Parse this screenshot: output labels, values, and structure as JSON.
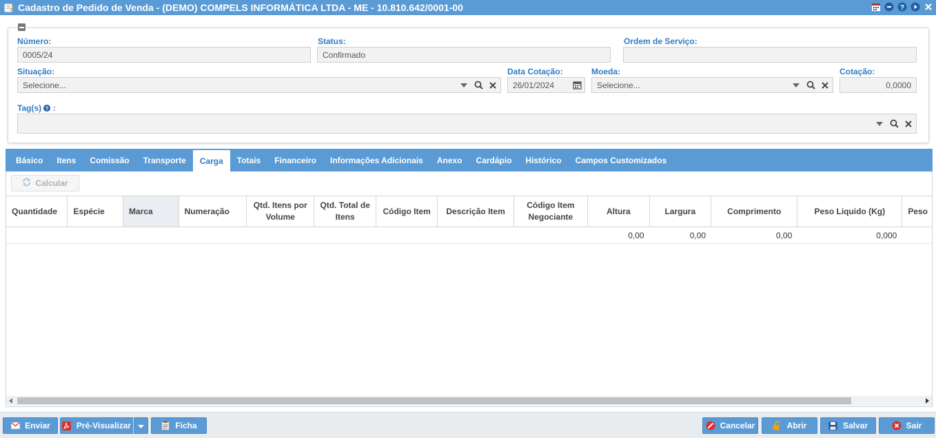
{
  "window": {
    "title": "Cadastro de Pedido de Venda - (DEMO) COMPELS INFORMÁTICA LTDA - ME - 10.810.642/0001-00"
  },
  "header": {
    "numero": {
      "label": "Número:",
      "value": "0005/24"
    },
    "status": {
      "label": "Status:",
      "value": "Confirmado"
    },
    "ordem_servico": {
      "label": "Ordem de Serviço:",
      "value": ""
    },
    "situacao": {
      "label": "Situação:",
      "value": "Selecione..."
    },
    "data_cotacao": {
      "label": "Data Cotação:",
      "value": "26/01/2024"
    },
    "moeda": {
      "label": "Moeda:",
      "value": "Selecione..."
    },
    "cotacao": {
      "label": "Cotação:",
      "value": "0,0000"
    },
    "tags": {
      "label": "Tag(s)",
      "value": ""
    }
  },
  "tabs": [
    "Básico",
    "Itens",
    "Comissão",
    "Transporte",
    "Carga",
    "Totais",
    "Financeiro",
    "Informações Adicionais",
    "Anexo",
    "Cardápio",
    "Histórico",
    "Campos Customizados"
  ],
  "active_tab": "Carga",
  "toolbar": {
    "calcular_label": "Calcular"
  },
  "grid": {
    "columns": [
      "Quantidade",
      "Espécie",
      "Marca",
      "Numeração",
      "Qtd. Itens por Volume",
      "Qtd. Total de Itens",
      "Código Item",
      "Descrição Item",
      "Código Item Negociante",
      "Altura",
      "Largura",
      "Comprimento",
      "Peso Liquido (Kg)",
      "Peso"
    ],
    "rows": [
      [
        "",
        "",
        "",
        "",
        "",
        "",
        "",
        "",
        "",
        "0,00",
        "0,00",
        "0,00",
        "0,000",
        ""
      ]
    ]
  },
  "footer": {
    "enviar": "Enviar",
    "pre_visualizar": "Pré-Visualizar",
    "ficha": "Ficha",
    "cancelar": "Cancelar",
    "abrir": "Abrir",
    "salvar": "Salvar",
    "sair": "Sair"
  },
  "colors": {
    "accent": "#5b9bd5",
    "label": "#2e7cc4",
    "cancel_icon": "#d9302b",
    "pdf_icon": "#d9302b",
    "abrir_icon": "#f2a200"
  },
  "icons": {
    "title": "edit-note-icon",
    "window_controls": [
      "calendar-icon",
      "minimize-icon",
      "help-icon",
      "play-icon",
      "close-icon"
    ]
  }
}
